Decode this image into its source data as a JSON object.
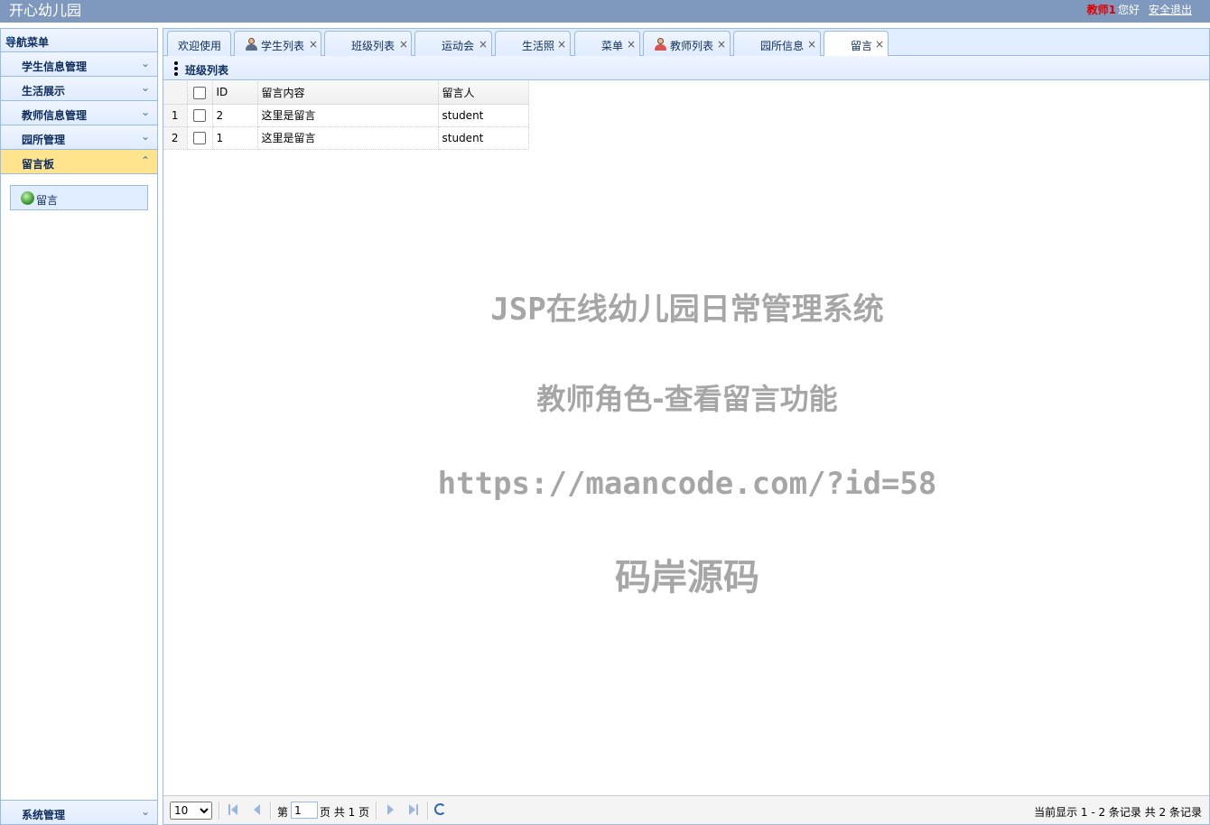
{
  "header": {
    "title": "开心幼儿园",
    "username": "教师1",
    "greeting": "您好",
    "logout": "安全退出"
  },
  "sidebar": {
    "title": "导航菜单",
    "panels": [
      {
        "label": "学生信息管理"
      },
      {
        "label": "生活展示"
      },
      {
        "label": "教师信息管理"
      },
      {
        "label": "园所管理"
      },
      {
        "label": "留言板",
        "active": true
      }
    ],
    "active_items": [
      {
        "label": "留言"
      }
    ],
    "bottom_panel": "系统管理"
  },
  "tabs": [
    {
      "label": "欢迎使用"
    },
    {
      "label": "学生列表",
      "icon": "student-icon"
    },
    {
      "label": "班级列表"
    },
    {
      "label": "运动会"
    },
    {
      "label": "生活照"
    },
    {
      "label": "菜单"
    },
    {
      "label": "教师列表",
      "icon": "teacher-icon"
    },
    {
      "label": "园所信息"
    },
    {
      "label": "留言",
      "active": true
    }
  ],
  "panel_title": "班级列表",
  "grid": {
    "columns": [
      "ID",
      "留言内容",
      "留言人"
    ],
    "rows": [
      {
        "num": "1",
        "id": "2",
        "content": "这里是留言",
        "author": "student"
      },
      {
        "num": "2",
        "id": "1",
        "content": "这里是留言",
        "author": "student"
      }
    ]
  },
  "watermark": {
    "line1": "JSP在线幼儿园日常管理系统",
    "line2": "教师角色-查看留言功能",
    "line3": "https://maancode.com/?id=58",
    "line4": "码岸源码"
  },
  "pager": {
    "page_size": "10",
    "page_prefix": "第",
    "page_value": "1",
    "page_suffix": "页 共 1 页",
    "info": "当前显示 1 - 2 条记录 共 2 条记录"
  }
}
